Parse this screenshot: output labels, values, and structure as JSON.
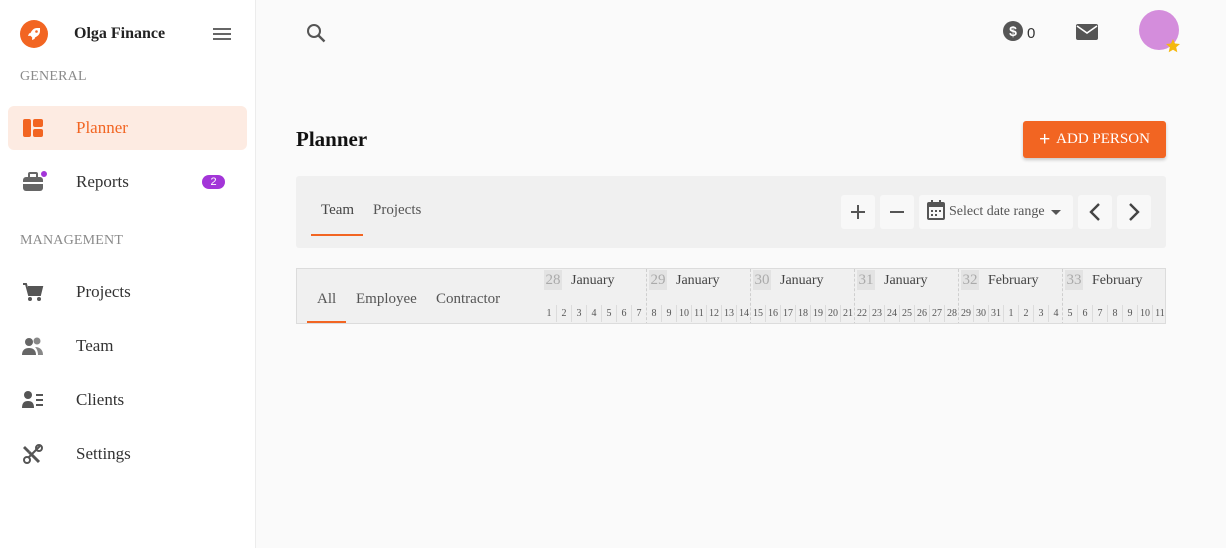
{
  "brand": {
    "name": "Olga Finance",
    "logo_icon": "rocket-icon",
    "accent": "#f26522"
  },
  "sidebar": {
    "general_label": "GENERAL",
    "management_label": "MANAGEMENT",
    "items": [
      {
        "label": "Planner",
        "icon": "planner-icon",
        "active": true
      },
      {
        "label": "Reports",
        "icon": "briefcase-icon",
        "badge": "2"
      },
      {
        "label": "Projects",
        "icon": "cart-icon"
      },
      {
        "label": "Team",
        "icon": "people-icon"
      },
      {
        "label": "Clients",
        "icon": "contact-list-icon"
      },
      {
        "label": "Settings",
        "icon": "tools-icon"
      }
    ]
  },
  "header": {
    "credits": "0",
    "credits_icon": "dollar-circle-icon",
    "mail_icon": "mail-icon",
    "avatar_color": "#d48ddc"
  },
  "main": {
    "title": "Planner",
    "add_button": "ADD PERSON",
    "tabs": [
      "Team",
      "Projects"
    ],
    "date_range_placeholder": "Select date range",
    "filters": [
      "All",
      "Employee",
      "Contractor"
    ],
    "weeks": [
      {
        "num": "28",
        "month": "January",
        "days": [
          "1",
          "2",
          "3",
          "4",
          "5",
          "6",
          "7"
        ]
      },
      {
        "num": "29",
        "month": "January",
        "days": [
          "8",
          "9",
          "10",
          "11",
          "12",
          "13",
          "14"
        ]
      },
      {
        "num": "30",
        "month": "January",
        "days": [
          "15",
          "16",
          "17",
          "18",
          "19",
          "20",
          "21"
        ]
      },
      {
        "num": "31",
        "month": "January",
        "days": [
          "22",
          "23",
          "24",
          "25",
          "26",
          "27",
          "28"
        ]
      },
      {
        "num": "32",
        "month": "February",
        "days": [
          "29",
          "30",
          "31",
          "1",
          "2",
          "3",
          "4"
        ]
      },
      {
        "num": "33",
        "month": "February",
        "days": [
          "5",
          "6",
          "7",
          "8",
          "9",
          "10",
          "11"
        ]
      }
    ]
  }
}
